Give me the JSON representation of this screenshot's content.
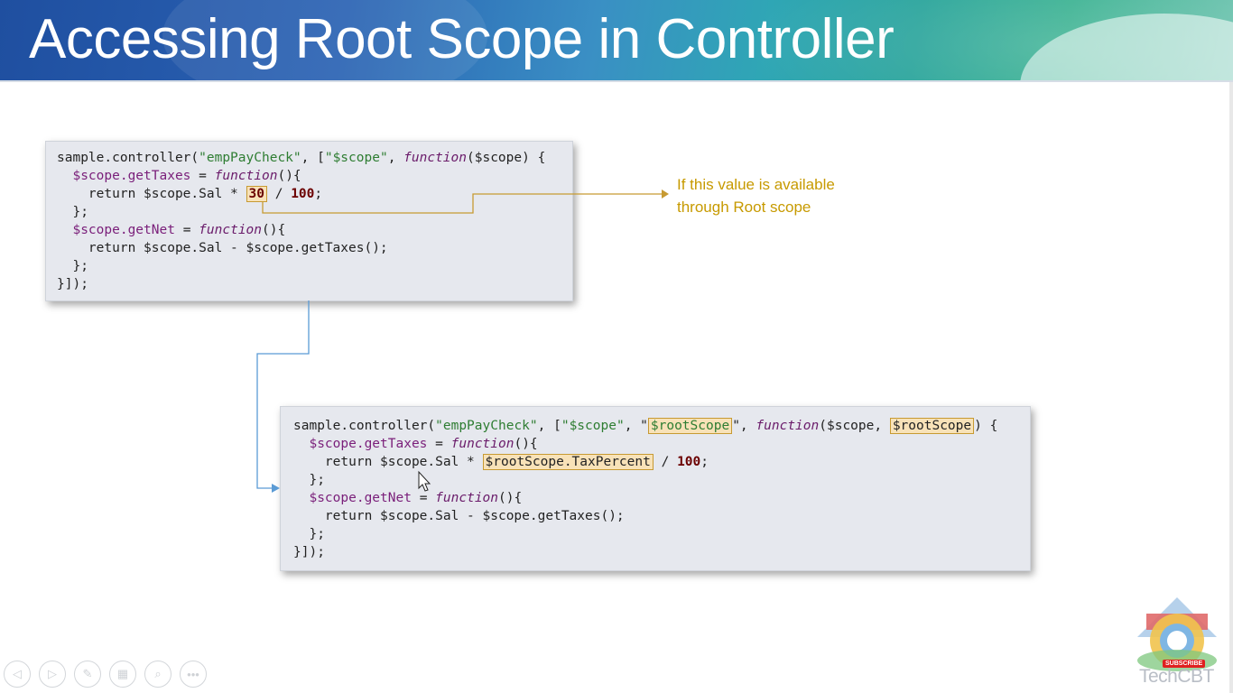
{
  "slide": {
    "title": "Accessing Root Scope in Controller",
    "callout_line1": "If this value is available",
    "callout_line2": "through Root scope"
  },
  "code1": {
    "l1_a": "sample.controller(",
    "l1_str1": "\"empPayCheck\"",
    "l1_b": ", [",
    "l1_str2": "\"$scope\"",
    "l1_c": ", ",
    "l1_fn": "function",
    "l1_d": "($scope) {",
    "l2_var": "$scope.getTaxes",
    "l2_a": " = ",
    "l2_fn": "function",
    "l2_b": "(){",
    "l3_a": "return $scope.Sal * ",
    "l3_num": "30",
    "l3_b": " / ",
    "l3_num2": "100",
    "l3_c": ";",
    "l4": "};",
    "l5_var": "$scope.getNet",
    "l5_a": " = ",
    "l5_fn": "function",
    "l5_b": "(){",
    "l6": "return $scope.Sal - $scope.getTaxes();",
    "l7": "};",
    "l8": "}]);"
  },
  "code2": {
    "l1_a": "sample.controller(",
    "l1_str1": "\"empPayCheck\"",
    "l1_b": ", [",
    "l1_str2": "\"$scope\"",
    "l1_c": ", \"",
    "l1_hl1": "$rootScope",
    "l1_d": "\", ",
    "l1_fn": "function",
    "l1_e": "($scope, ",
    "l1_hl2": "$rootScope",
    "l1_f": ") {",
    "l2_var": "$scope.getTaxes",
    "l2_a": " = ",
    "l2_fn": "function",
    "l2_b": "(){",
    "l3_a": "return $scope.Sal * ",
    "l3_hl": "$rootScope.TaxPercent",
    "l3_b": " / ",
    "l3_num": "100",
    "l3_c": ";",
    "l4": "};",
    "l5_var": "$scope.getNet",
    "l5_a": " = ",
    "l5_fn": "function",
    "l5_b": "(){",
    "l6": "return $scope.Sal - $scope.getTaxes();",
    "l7": "};",
    "l8": "}]);"
  },
  "toolbar": {
    "prev_icon": "◁",
    "next_icon": "▷",
    "pen_icon": "✎",
    "slides_icon": "▦",
    "zoom_icon": "⌕",
    "more_icon": "•••"
  },
  "logo": {
    "subscribe_label": "SUBSCRIBE",
    "brand": "TechCBT"
  },
  "colors": {
    "accent_orange": "#c79a00",
    "connector_blue": "#5b9bd5",
    "highlight_fill": "#f8e2b8"
  }
}
